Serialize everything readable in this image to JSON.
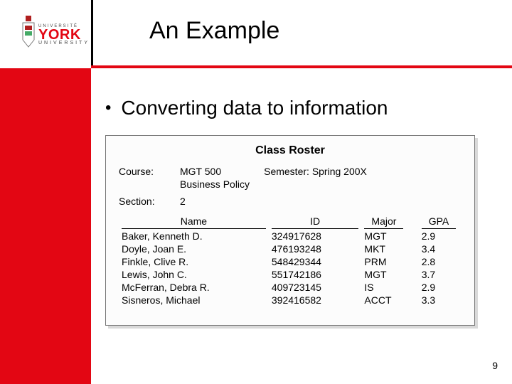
{
  "logo": {
    "line1": "UNIVERSITÉ",
    "name": "YORK",
    "line2": "UNIVERSITY"
  },
  "title": "An Example",
  "bullet": "Converting data to information",
  "figure": {
    "title": "Class Roster",
    "course_label": "Course:",
    "course_code": "MGT 500",
    "course_name": "Business Policy",
    "semester_label": "Semester:",
    "semester_value": "Spring 200X",
    "section_label": "Section:",
    "section_value": "2",
    "headers": {
      "name": "Name",
      "id": "ID",
      "major": "Major",
      "gpa": "GPA"
    },
    "rows": [
      {
        "name": "Baker, Kenneth D.",
        "id": "324917628",
        "major": "MGT",
        "gpa": "2.9"
      },
      {
        "name": "Doyle, Joan E.",
        "id": "476193248",
        "major": "MKT",
        "gpa": "3.4"
      },
      {
        "name": "Finkle, Clive R.",
        "id": "548429344",
        "major": "PRM",
        "gpa": "2.8"
      },
      {
        "name": "Lewis, John C.",
        "id": "551742186",
        "major": "MGT",
        "gpa": "3.7"
      },
      {
        "name": "McFerran, Debra R.",
        "id": "409723145",
        "major": "IS",
        "gpa": "2.9"
      },
      {
        "name": "Sisneros, Michael",
        "id": "392416582",
        "major": "ACCT",
        "gpa": "3.3"
      }
    ]
  },
  "page_number": "9",
  "colors": {
    "brand_red": "#e30613"
  }
}
